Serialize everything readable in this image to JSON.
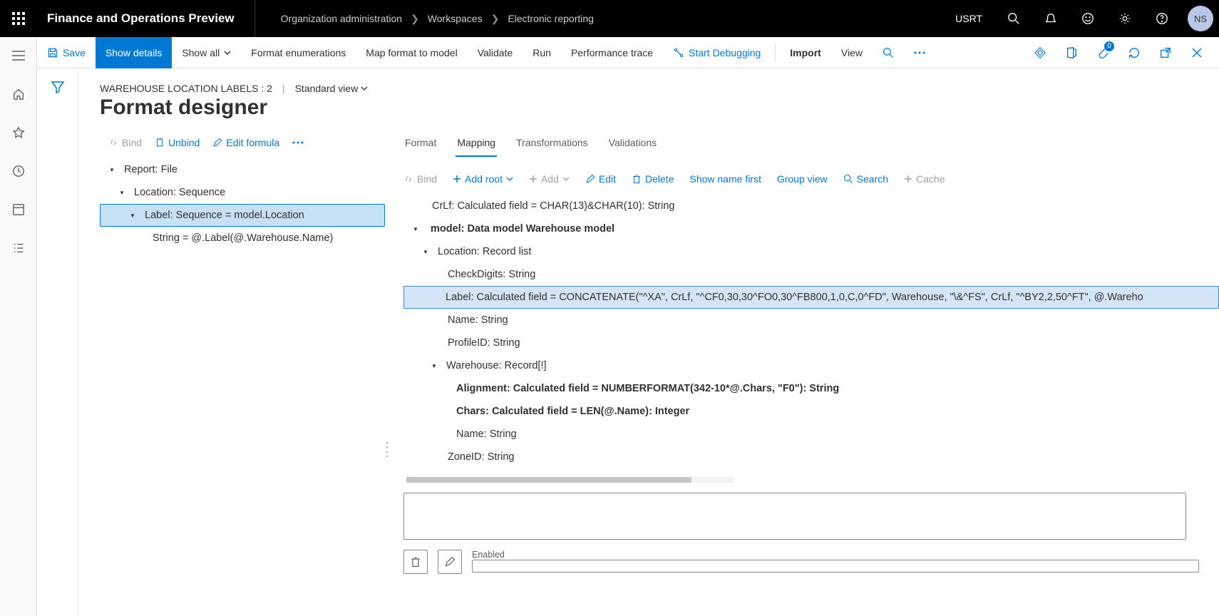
{
  "topbar": {
    "app_title": "Finance and Operations Preview",
    "breadcrumb": [
      "Organization administration",
      "Workspaces",
      "Electronic reporting"
    ],
    "user_label": "USRT",
    "avatar": "NS"
  },
  "cmdbar": {
    "save": "Save",
    "show_details": "Show details",
    "show_all": "Show all",
    "format_enum": "Format enumerations",
    "map_format": "Map format to model",
    "validate": "Validate",
    "run": "Run",
    "perf": "Performance trace",
    "debug": "Start Debugging",
    "import": "Import",
    "view": "View",
    "attach_count": "0"
  },
  "header": {
    "context": "WAREHOUSE LOCATION LABELS : 2",
    "view_name": "Standard view",
    "title": "Format designer"
  },
  "left_tools": {
    "bind": "Bind",
    "unbind": "Unbind",
    "edit_formula": "Edit formula"
  },
  "left_tree": [
    {
      "label": "Report: File",
      "level": 0,
      "caret": "down",
      "selected": false
    },
    {
      "label": "Location: Sequence",
      "level": 1,
      "caret": "down",
      "selected": false
    },
    {
      "label": "Label: Sequence = model.Location",
      "level": 2,
      "caret": "down",
      "selected": true
    },
    {
      "label": "String = @.Label(@.Warehouse.Name)",
      "level": 3,
      "caret": "",
      "selected": false
    }
  ],
  "tabs": {
    "format": "Format",
    "mapping": "Mapping",
    "transformations": "Transformations",
    "validations": "Validations"
  },
  "right_tools": {
    "bind": "Bind",
    "add_root": "Add root",
    "add": "Add",
    "edit": "Edit",
    "delete": "Delete",
    "show_name": "Show name first",
    "group": "Group view",
    "search": "Search",
    "cache": "Cache"
  },
  "right_tree": [
    {
      "label": "CrLf: Calculated field = CHAR(13)&CHAR(10): String",
      "level": 0,
      "caret": "",
      "bold": false,
      "selected": false
    },
    {
      "label": "model: Data model Warehouse model",
      "level": 0,
      "caret": "down",
      "bold": true,
      "selected": false
    },
    {
      "label": "Location: Record list",
      "level": 1,
      "caret": "down",
      "bold": false,
      "selected": false
    },
    {
      "label": "CheckDigits: String",
      "level": 2,
      "caret": "",
      "bold": false,
      "selected": false
    },
    {
      "label": "Label: Calculated field = CONCATENATE(\"^XA\", CrLf, \"^CF0,30,30^FO0,30^FB800,1,0,C,0^FD\", Warehouse, \"\\&^FS\", CrLf, \"^BY2,2,50^FT\", @.Wareho",
      "level": 2,
      "caret": "",
      "bold": false,
      "selected": true
    },
    {
      "label": "Name: String",
      "level": 2,
      "caret": "",
      "bold": false,
      "selected": false
    },
    {
      "label": "ProfileID: String",
      "level": 2,
      "caret": "",
      "bold": false,
      "selected": false
    },
    {
      "label": "Warehouse: Record[!]",
      "level": 1,
      "caret": "down",
      "bold": false,
      "selected": false
    },
    {
      "label": "Alignment: Calculated field = NUMBERFORMAT(342-10*@.Chars, \"F0\"): String",
      "level": 2,
      "caret": "",
      "bold": true,
      "selected": false
    },
    {
      "label": "Chars: Calculated field = LEN(@.Name): Integer",
      "level": 2,
      "caret": "",
      "bold": true,
      "selected": false
    },
    {
      "label": "Name: String",
      "level": 2,
      "caret": "",
      "bold": false,
      "selected": false
    },
    {
      "label": "ZoneID: String",
      "level": 2,
      "caret": "",
      "bold": false,
      "selected": false
    }
  ],
  "bottom": {
    "enabled_label": "Enabled"
  }
}
